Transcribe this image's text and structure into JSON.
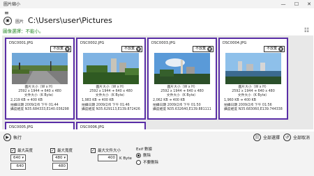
{
  "window": {
    "title": "圖片縮小",
    "minimize": "—",
    "maximize": "☐",
    "close": "✕"
  },
  "menu_icon": "hamburger-icon",
  "path": {
    "label": "圖片",
    "value": "C:\\Users\\user\\Pictures"
  },
  "selection_status": "圖像選擇：不能小。",
  "cards": [
    {
      "filename": "DSC0001.JPG",
      "select": "不放棄",
      "dims_label": "圖片大小（W x H）",
      "dims": "2592 x 1944  ➜  640 x 480",
      "size_label": "文件大小（K Byte）",
      "size": "2,219 KB  ➜  400 KB",
      "date": "拍攝日期  2009/2/6 下午 01:44",
      "gps": "攝度經度  N35.684333,E140.036298"
    },
    {
      "filename": "DSC0002.JPG",
      "select": "不放棄",
      "dims_label": "圖片大小（W x H）",
      "dims": "2592 x 1944  ➜  640 x 480",
      "size_label": "文件大小（K Byte）",
      "size": "1,983 KB  ➜  400 KB",
      "date": "拍攝日期  2009/2/6 下午 01:46",
      "gps": "攝度經度  N35.629113,E139.872426"
    },
    {
      "filename": "DSC0003.JPG",
      "select": "不放棄",
      "dims_label": "圖片大小（W x H）",
      "dims": "2592 x 1944  ➜  640 x 480",
      "size_label": "文件大小（K Byte）",
      "size": "2,062 KB  ➜  400 KB",
      "date": "拍攝日期  2009/2/6 下午 01:50",
      "gps": "攝度經度  N35.632640,E139.881111"
    },
    {
      "filename": "DSC0004.JPG",
      "select": "不放棄",
      "dims_label": "圖片大小（W x H）",
      "dims": "2592 x 1944  ➜  640 x 480",
      "size_label": "文件大小（K Byte）",
      "size": "1,960 KB  ➜  400 KB",
      "date": "拍攝日期  2009/2/6 下午 01:56",
      "gps": "攝度經度  N35.683060,E139.744338"
    },
    {
      "filename": "DSC0005.JPG"
    },
    {
      "filename": "DSC0006.JPG"
    }
  ],
  "actions": {
    "run": "執行",
    "select_all": "全部選擇",
    "cancel_all": "全部取消"
  },
  "settings": {
    "max_height_label": "最大高度",
    "max_height_select": "640",
    "max_height_value": "640",
    "max_width_label": "最大寬度",
    "max_width_select": "480",
    "max_width_value": "480",
    "max_size_label": "最大文件大小",
    "max_size_value": "400",
    "size_unit": "K Byte",
    "exif_label": "Exif 數據",
    "exif_opt1": "刪除",
    "exif_opt2": "不要刪除"
  },
  "colors": {
    "card_border": "#5a2ea6",
    "status_green": "#2e8b2e"
  }
}
